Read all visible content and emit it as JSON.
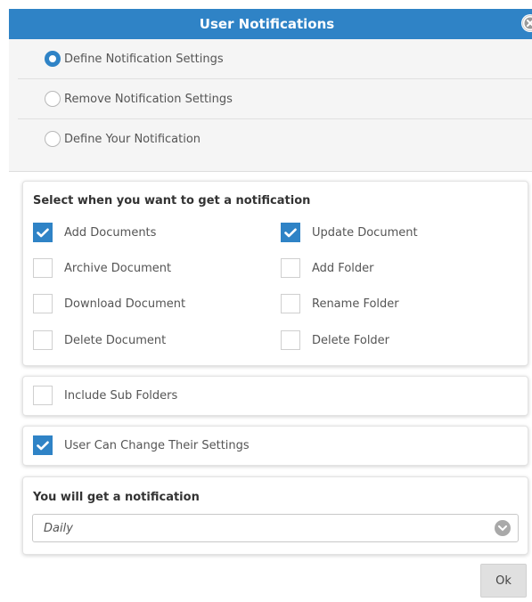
{
  "dialog": {
    "title": "User Notifications"
  },
  "modes": [
    {
      "label": "Define Notification Settings",
      "selected": true
    },
    {
      "label": "Remove Notification Settings",
      "selected": false
    },
    {
      "label": "Define Your Notification",
      "selected": false
    }
  ],
  "events_panel": {
    "heading": "Select when you want to get a notification",
    "events": [
      {
        "label": "Add Documents",
        "checked": true
      },
      {
        "label": "Update Document",
        "checked": true
      },
      {
        "label": "Archive Document",
        "checked": false
      },
      {
        "label": "Add Folder",
        "checked": false
      },
      {
        "label": "Download Document",
        "checked": false
      },
      {
        "label": "Rename Folder",
        "checked": false
      },
      {
        "label": "Delete Document",
        "checked": false
      },
      {
        "label": "Delete Folder",
        "checked": false
      }
    ]
  },
  "include_subfolders": {
    "label": "Include Sub Folders",
    "checked": false
  },
  "user_can_change": {
    "label": "User Can Change Their Settings",
    "checked": true
  },
  "frequency": {
    "heading": "You will get a notification",
    "selected": "Daily"
  },
  "ok_label": "Ok",
  "colors": {
    "accent": "#2f83c6",
    "title_text": "#ffffff"
  }
}
